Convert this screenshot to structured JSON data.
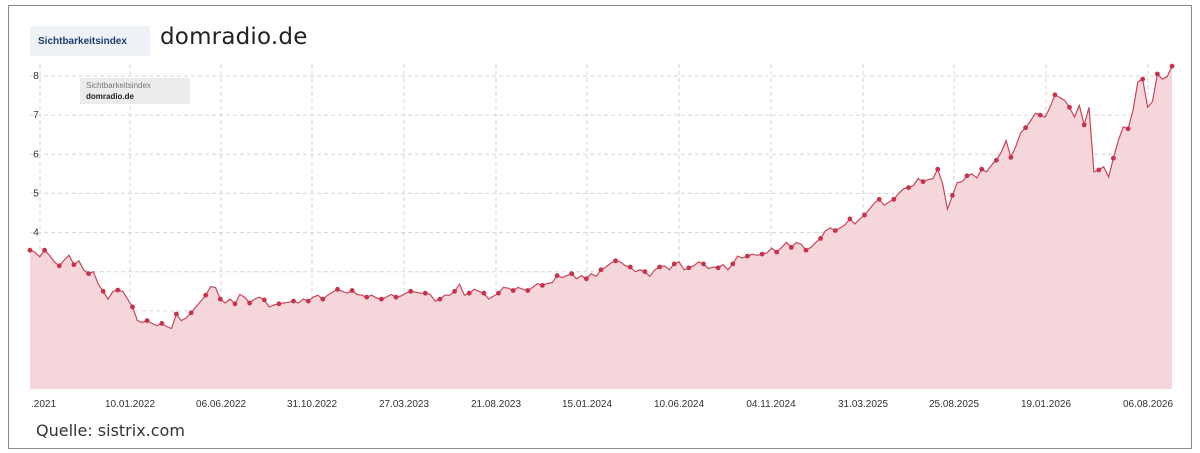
{
  "header": {
    "badge_label": "Sichtbarkeitsindex",
    "site_title": "domradio.de"
  },
  "footer": {
    "source": "Quelle: sistrix.com"
  },
  "legend": {
    "metric": "Sichtbarkeitsindex",
    "domain": "domradio.de"
  },
  "colors": {
    "line": "#c8465b",
    "fill": "#f5d6db",
    "marker": "#c8324a",
    "grid": "#d6d6d6"
  },
  "chart_data": {
    "type": "area",
    "y_ticks": [
      "1",
      "2",
      "3",
      "4",
      "5",
      "6",
      "7",
      "8"
    ],
    "ylim": [
      0,
      8.3
    ],
    "x_tick_labels": [
      ".2021",
      "10.01.2022",
      "06.06.2022",
      "31.10.2022",
      "27.03.2023",
      "21.08.2023",
      "15.01.2024",
      "10.06.2024",
      "04.11.2024",
      "31.03.2025",
      "25.08.2025",
      "19.01.2026",
      "06.08.2026"
    ],
    "grid": true,
    "legend_position": "top-left",
    "series": [
      {
        "values": [
          3.55,
          3.5,
          3.38,
          3.55,
          3.42,
          3.25,
          3.15,
          3.3,
          3.42,
          3.18,
          3.28,
          3.05,
          2.95,
          3.0,
          2.68,
          2.5,
          2.3,
          2.5,
          2.53,
          2.5,
          2.3,
          2.1,
          1.75,
          1.7,
          1.75,
          1.68,
          1.62,
          1.68,
          1.6,
          1.55,
          1.92,
          1.75,
          1.82,
          1.95,
          2.1,
          2.25,
          2.4,
          2.62,
          2.6,
          2.3,
          2.2,
          2.3,
          2.18,
          2.42,
          2.35,
          2.2,
          2.3,
          2.35,
          2.28,
          2.1,
          2.15,
          2.18,
          2.2,
          2.22,
          2.25,
          2.2,
          2.3,
          2.25,
          2.35,
          2.4,
          2.3,
          2.4,
          2.48,
          2.55,
          2.5,
          2.45,
          2.52,
          2.42,
          2.4,
          2.35,
          2.4,
          2.33,
          2.3,
          2.35,
          2.42,
          2.35,
          2.38,
          2.45,
          2.5,
          2.48,
          2.45,
          2.45,
          2.42,
          2.25,
          2.3,
          2.4,
          2.4,
          2.5,
          2.68,
          2.4,
          2.45,
          2.55,
          2.5,
          2.45,
          2.3,
          2.38,
          2.45,
          2.6,
          2.58,
          2.52,
          2.6,
          2.55,
          2.52,
          2.6,
          2.7,
          2.65,
          2.7,
          2.72,
          2.9,
          2.85,
          2.9,
          2.95,
          2.82,
          2.9,
          2.82,
          2.95,
          2.88,
          3.05,
          3.12,
          3.22,
          3.28,
          3.25,
          3.15,
          3.12,
          3.0,
          3.05,
          3.0,
          2.88,
          3.05,
          3.12,
          3.15,
          3.05,
          3.2,
          3.25,
          3.05,
          3.1,
          3.15,
          3.25,
          3.2,
          3.08,
          3.12,
          3.1,
          3.18,
          3.05,
          3.2,
          3.4,
          3.35,
          3.4,
          3.45,
          3.42,
          3.45,
          3.48,
          3.6,
          3.5,
          3.62,
          3.75,
          3.62,
          3.75,
          3.7,
          3.55,
          3.62,
          3.75,
          3.85,
          4.05,
          4.12,
          4.05,
          4.12,
          4.2,
          4.35,
          4.22,
          4.35,
          4.45,
          4.6,
          4.75,
          4.85,
          4.7,
          4.78,
          4.85,
          5.0,
          5.12,
          5.15,
          5.2,
          5.38,
          5.3,
          5.35,
          5.38,
          5.62,
          5.25,
          4.6,
          4.95,
          5.28,
          5.3,
          5.45,
          5.5,
          5.4,
          5.62,
          5.55,
          5.72,
          5.85,
          6.05,
          6.35,
          5.92,
          6.2,
          6.55,
          6.68,
          6.85,
          7.05,
          7.0,
          6.95,
          7.2,
          7.52,
          7.45,
          7.38,
          7.2,
          6.95,
          7.25,
          6.75,
          7.2,
          5.55,
          5.6,
          5.68,
          5.42,
          5.9,
          6.35,
          6.7,
          6.65,
          7.12,
          7.85,
          7.92,
          7.2,
          7.35,
          8.05,
          7.92,
          7.98,
          8.25
        ]
      }
    ]
  }
}
